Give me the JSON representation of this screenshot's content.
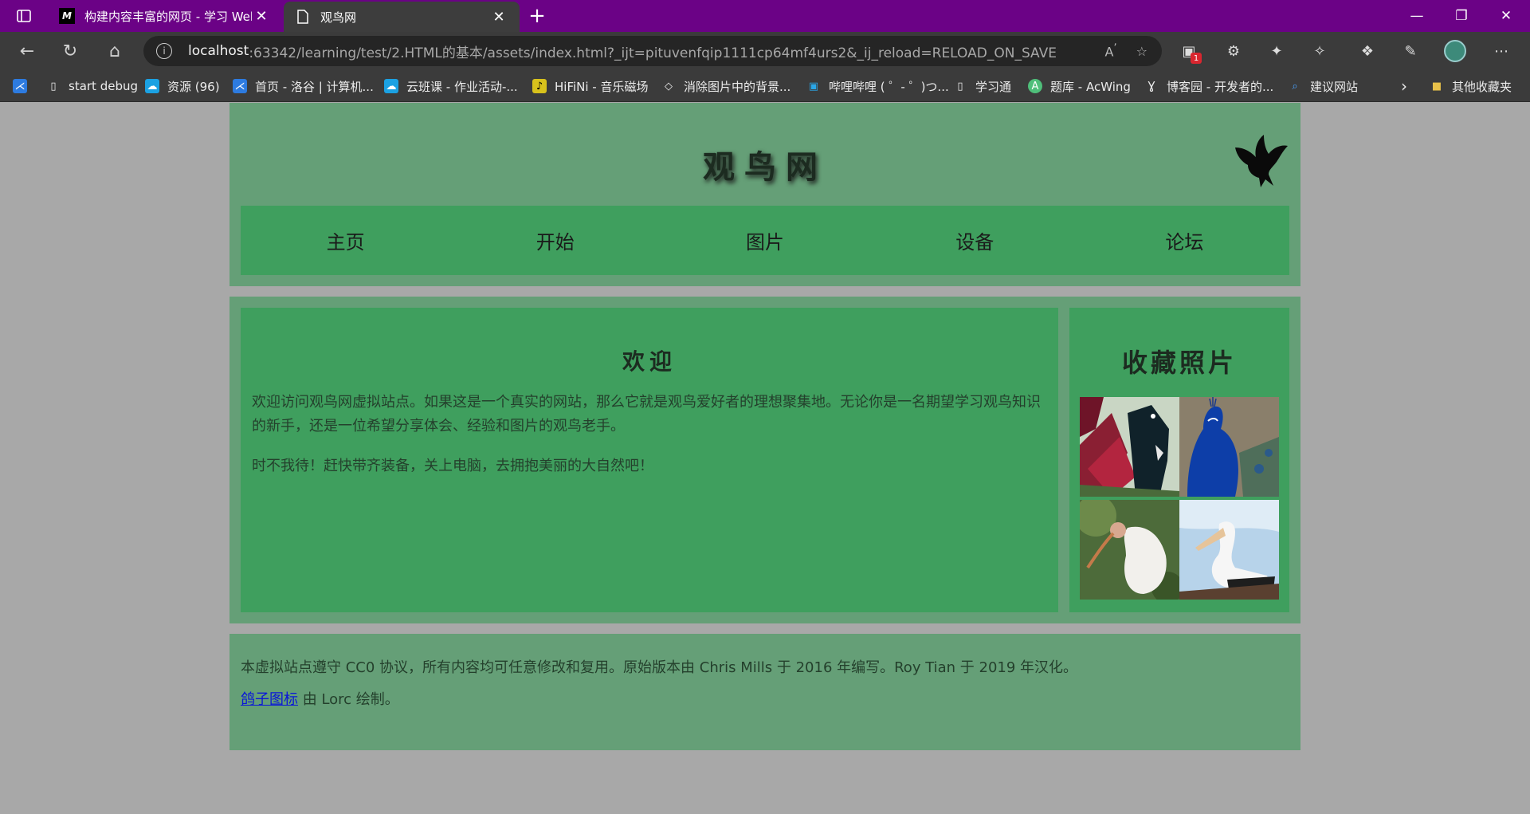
{
  "browser": {
    "tabs": [
      {
        "title": "构建内容丰富的网页 - 学习 Web",
        "icon": "mdn-icon"
      },
      {
        "title": "观鸟网",
        "icon": "page-icon",
        "active": true
      }
    ],
    "url_host": "localhost",
    "url_rest": ":63342/learning/test/2.HTML的基本/assets/index.html?_ijt=pituvenfqip1111cp64mf4urs2&_ij_reload=RELOAD_ON_SAVE",
    "extension_badge": "1",
    "bookmarks": [
      {
        "label": "start debug",
        "icon": "bookmark-app-icon"
      },
      {
        "label": "资源 (96)",
        "icon": "cloud-class-icon"
      },
      {
        "label": "首页 - 洛谷 | 计算机...",
        "icon": "luogu-icon"
      },
      {
        "label": "云班课 - 作业活动-...",
        "icon": "cloud-class-icon"
      },
      {
        "label": "HiFiNi - 音乐磁场",
        "icon": "music-icon"
      },
      {
        "label": "消除图片中的背景...",
        "icon": "layers-icon"
      },
      {
        "label": "哔哩哔哩 ( ゜- ゜)つ...",
        "icon": "bilibili-icon"
      },
      {
        "label": "学习通",
        "icon": "page-icon"
      },
      {
        "label": "题库 - AcWing",
        "icon": "acwing-icon"
      },
      {
        "label": "博客园 - 开发者的...",
        "icon": "cnblogs-icon"
      },
      {
        "label": "建议网站",
        "icon": "search-icon"
      }
    ],
    "other_bookmarks": "其他收藏夹"
  },
  "page": {
    "site_title": "观鸟网",
    "nav": [
      "主页",
      "开始",
      "图片",
      "设备",
      "论坛"
    ],
    "article": {
      "heading": "欢迎",
      "p1": "欢迎访问观鸟网虚拟站点。如果这是一个真实的网站，那么它就是观鸟爱好者的理想聚集地。无论你是一名期望学习观鸟知识的新手，还是一位希望分享体会、经验和图片的观鸟老手。",
      "p2": "时不我待！赶快带齐装备，关上电脑，去拥抱美丽的大自然吧！"
    },
    "aside": {
      "heading": "收藏照片",
      "photos": [
        "tui-bird-photo",
        "peacock-photo",
        "ibis-photo",
        "pelican-photo"
      ]
    },
    "footer": {
      "license": "本虚拟站点遵守 CC0 协议，所有内容均可任意修改和复用。原始版本由 Chris Mills 于 2016 年编写。Roy Tian 于 2019 年汉化。",
      "link_text": "鸽子图标",
      "credit": " 由 Lorc 绘制。"
    },
    "colors": {
      "page_bg": "#a8a8a8",
      "block_bg": "#659f77",
      "inner_bg": "#3f9f5e",
      "link": "#0a16d8",
      "tab_bar": "#6b0286"
    }
  }
}
